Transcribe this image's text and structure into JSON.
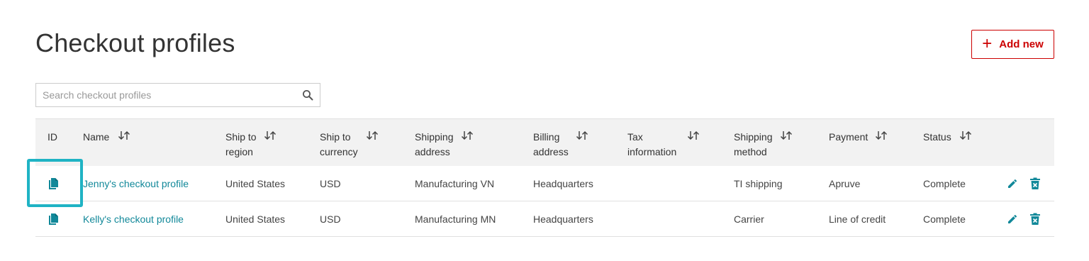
{
  "page": {
    "title": "Checkout profiles"
  },
  "toolbar": {
    "add_label": "Add new"
  },
  "search": {
    "placeholder": "Search checkout profiles"
  },
  "colors": {
    "accent_red": "#cc0000",
    "link_teal": "#118899",
    "highlight": "#1fb3c4"
  },
  "table": {
    "columns": [
      {
        "line1": "ID",
        "line2": "",
        "sortable": false
      },
      {
        "line1": "Name",
        "line2": "",
        "sortable": true
      },
      {
        "line1": "Ship to",
        "line2": "region",
        "sortable": true
      },
      {
        "line1": "Ship to",
        "line2": "currency",
        "sortable": true
      },
      {
        "line1": "Shipping",
        "line2": "address",
        "sortable": true
      },
      {
        "line1": "Billing",
        "line2": "address",
        "sortable": true
      },
      {
        "line1": "Tax",
        "line2": "information",
        "sortable": true
      },
      {
        "line1": "Shipping",
        "line2": "method",
        "sortable": true
      },
      {
        "line1": "Payment",
        "line2": "",
        "sortable": true
      },
      {
        "line1": "Status",
        "line2": "",
        "sortable": true
      }
    ],
    "rows": [
      {
        "name": "Jenny's checkout profile",
        "region": "United States",
        "currency": "USD",
        "shipping_address": "Manufacturing VN",
        "billing_address": "Headquarters",
        "tax_information": "",
        "shipping_method": "TI shipping",
        "payment": "Apruve",
        "status": "Complete"
      },
      {
        "name": "Kelly's checkout profile",
        "region": "United States",
        "currency": "USD",
        "shipping_address": "Manufacturing MN",
        "billing_address": "Headquarters",
        "tax_information": "",
        "shipping_method": "Carrier",
        "payment": "Line of credit",
        "status": "Complete"
      }
    ]
  }
}
